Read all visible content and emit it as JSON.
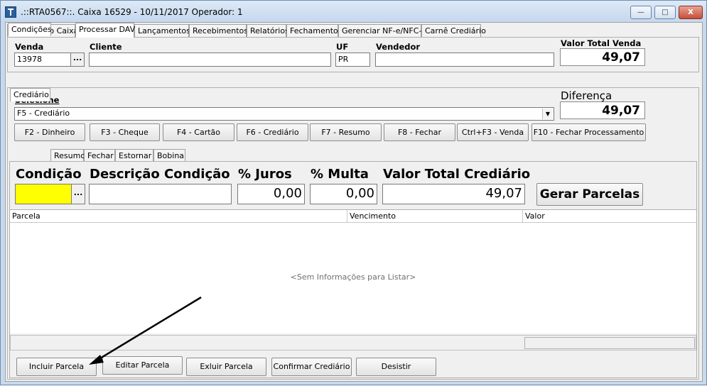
{
  "window": {
    "title": ".::RTA0567::. Caixa 16529 - 10/11/2017 Operador: 1",
    "minimize_glyph": "—",
    "maximize_glyph": "□",
    "close_glyph": "X"
  },
  "main_tabs": [
    {
      "label": "Venda pelo Caixa"
    },
    {
      "label": "Processar DAV"
    },
    {
      "label": "Lançamentos"
    },
    {
      "label": "Recebimentos"
    },
    {
      "label": "Relatórios"
    },
    {
      "label": "Fechamento"
    },
    {
      "label": "Gerenciar NF-e/NFC-e"
    },
    {
      "label": "Carnê Crediário"
    }
  ],
  "header": {
    "venda_label": "Venda",
    "venda_value": "13978",
    "cliente_label": "Cliente",
    "cliente_value": "",
    "uf_label": "UF",
    "uf_value": "PR",
    "vendedor_label": "Vendedor",
    "vendedor_value": "",
    "valor_total_label": "Valor Total Venda",
    "valor_total_value": "49,07",
    "ellipsis": "..."
  },
  "condicoes_tab": "Condições",
  "selecione": {
    "label": "Selecione",
    "selected": "F5 - Crediário",
    "diferenca_label": "Diferença",
    "diferenca_value": "49,07"
  },
  "payment_buttons": [
    {
      "label": "F2 - Dinheiro"
    },
    {
      "label": "F3 - Cheque"
    },
    {
      "label": "F4 - Cartão"
    },
    {
      "label": "F6 - Crediário"
    },
    {
      "label": "F7 - Resumo"
    },
    {
      "label": "F8 - Fechar"
    },
    {
      "label": "Ctrl+F3 - Venda"
    },
    {
      "label": "F10 - Fechar Processamento"
    }
  ],
  "sub_tabs": [
    {
      "label": "Crediário"
    },
    {
      "label": "Resumo"
    },
    {
      "label": "Fechar"
    },
    {
      "label": "Estornar"
    },
    {
      "label": "Bobina"
    }
  ],
  "crediario": {
    "condicao_label": "Condição",
    "condicao_value": "",
    "descricao_label": "Descrição Condição",
    "descricao_value": "",
    "juros_label": "% Juros",
    "juros_value": "0,00",
    "multa_label": "% Multa",
    "multa_value": "0,00",
    "valor_label": "Valor Total Crediário",
    "valor_value": "49,07",
    "gerar_button": "Gerar Parcelas",
    "highlight_color": "#ffff00"
  },
  "grid": {
    "columns": [
      "Parcela",
      "Vencimento",
      "Valor"
    ],
    "empty_text": "<Sem Informações para Listar>"
  },
  "bottom_buttons": [
    {
      "label": "Incluir Parcela"
    },
    {
      "label": "Editar Parcela"
    },
    {
      "label": "Exluir Parcela"
    },
    {
      "label": "Confirmar Crediário"
    },
    {
      "label": "Desistir"
    }
  ]
}
